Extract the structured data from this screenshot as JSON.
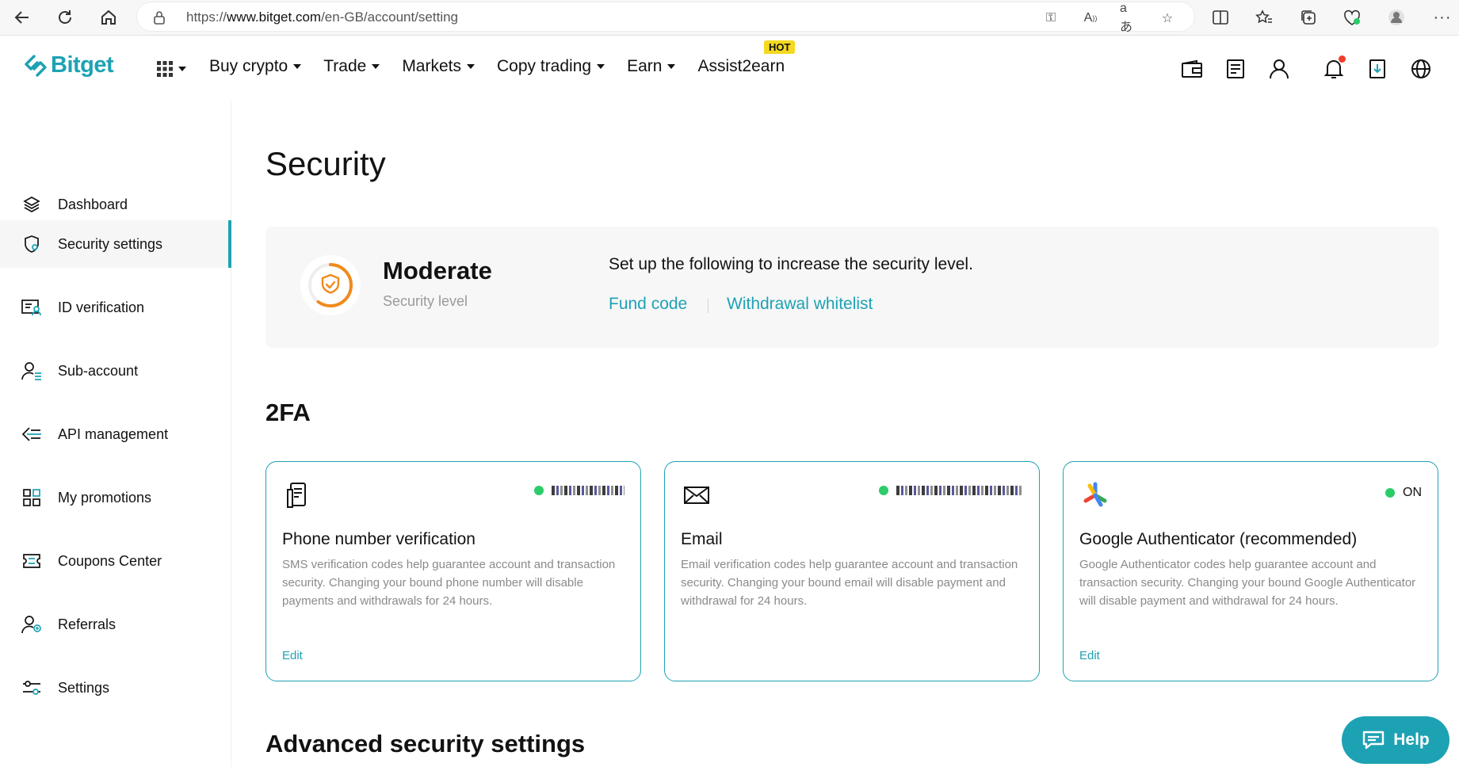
{
  "browser": {
    "url_prefix": "https://",
    "url_domain": "www.bitget.com",
    "url_path": "/en-GB/account/setting"
  },
  "header": {
    "logo": "Bitget",
    "menu": [
      {
        "label": "Buy crypto",
        "caret": true
      },
      {
        "label": "Trade",
        "caret": true
      },
      {
        "label": "Markets",
        "caret": true
      },
      {
        "label": "Copy trading",
        "caret": true
      },
      {
        "label": "Earn",
        "caret": true
      },
      {
        "label": "Assist2earn",
        "caret": false
      }
    ],
    "hot_badge": "HOT"
  },
  "sidebar": {
    "items": [
      {
        "label": "Dashboard",
        "icon": "layers-icon"
      },
      {
        "label": "Security settings",
        "icon": "shield-icon",
        "active": true
      },
      {
        "label": "ID verification",
        "icon": "id-card-icon"
      },
      {
        "label": "Sub-account",
        "icon": "sub-account-icon"
      },
      {
        "label": "API management",
        "icon": "api-icon"
      },
      {
        "label": "My promotions",
        "icon": "grid-icon"
      },
      {
        "label": "Coupons Center",
        "icon": "coupon-icon"
      },
      {
        "label": "Referrals",
        "icon": "referral-icon"
      },
      {
        "label": "Settings",
        "icon": "settings-slider-icon"
      }
    ]
  },
  "main": {
    "title": "Security",
    "level": {
      "name": "Moderate",
      "sub": "Security level",
      "hint": "Set up the following to increase the security level.",
      "links": [
        "Fund code",
        "Withdrawal whitelist"
      ],
      "progress": 0.6
    },
    "twofa_title": "2FA",
    "cards": [
      {
        "title": "Phone number verification",
        "desc": "SMS verification codes help guarantee account and transaction security. Changing your bound phone number will disable payments and withdrawals for 24 hours.",
        "status": "",
        "edit": "Edit",
        "icon": "phone-doc-icon"
      },
      {
        "title": "Email",
        "desc": "Email verification codes help guarantee account and transaction security. Changing your bound email will disable payment and withdrawal for 24 hours.",
        "status": "",
        "edit": "",
        "icon": "envelope-icon"
      },
      {
        "title": "Google Authenticator (recommended)",
        "desc": "Google Authenticator codes help guarantee account and transaction security. Changing your bound Google Authenticator will disable payment and withdrawal for 24 hours.",
        "status": "ON",
        "edit": "Edit",
        "icon": "google-authenticator-icon"
      }
    ],
    "advanced_title": "Advanced security settings"
  },
  "help_button": "Help",
  "colors": {
    "accent": "#1da2b4",
    "status_on": "#2ccc6a",
    "ring": "#f08a1c",
    "hot": "#f5d81f"
  }
}
